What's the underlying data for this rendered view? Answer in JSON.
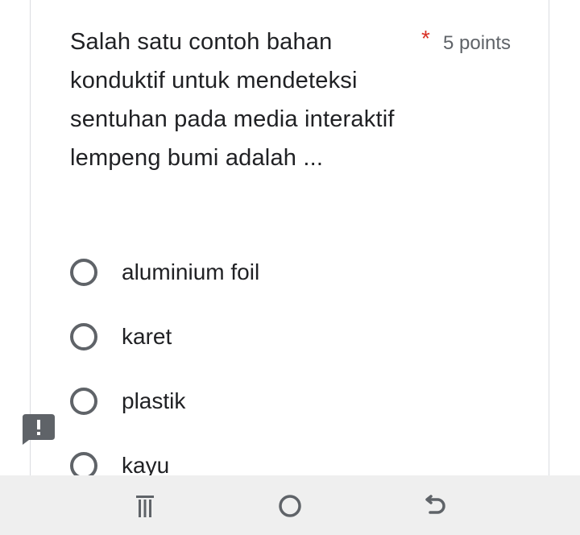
{
  "question": {
    "text": "Salah satu contoh bahan konduktif untuk mendeteksi sentuhan pada media interaktif lempeng bumi adalah ...",
    "required_marker": "*",
    "points": "5 points"
  },
  "options": [
    {
      "label": "aluminium foil"
    },
    {
      "label": "karet"
    },
    {
      "label": "plastik"
    },
    {
      "label": "kayu"
    }
  ],
  "colors": {
    "required": "#d93025",
    "feedback_badge": "#5f6368",
    "radio_border": "#5f6368",
    "navbar_bg": "#efefef"
  },
  "icons": {
    "feedback": "report-issue-icon",
    "nav_recents": "recents-icon",
    "nav_home": "home-icon",
    "nav_back": "back-icon"
  }
}
